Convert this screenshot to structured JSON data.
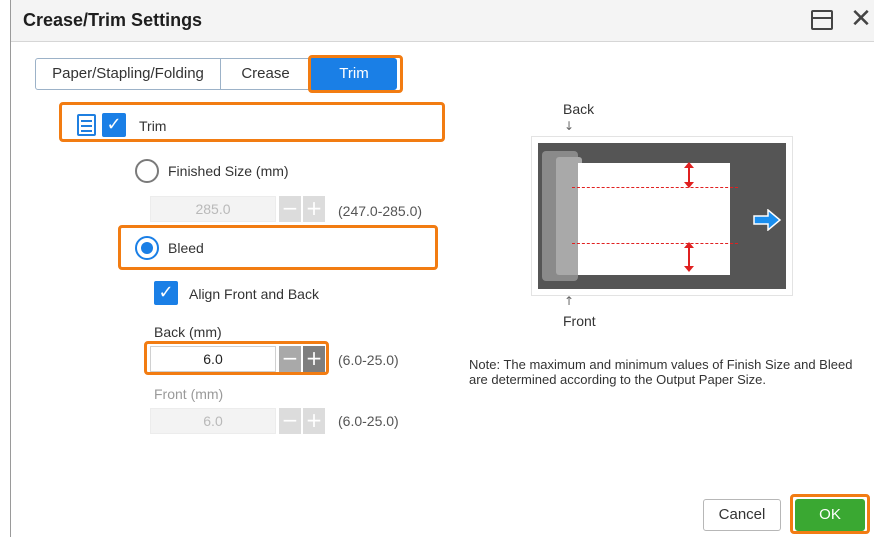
{
  "window": {
    "title": "Crease/Trim Settings"
  },
  "tabs": [
    {
      "label": "Paper/Stapling/Folding"
    },
    {
      "label": "Crease"
    },
    {
      "label": "Trim"
    }
  ],
  "trim": {
    "label": "Trim",
    "checked": true
  },
  "finished_size": {
    "label": "Finished Size (mm)",
    "value": "285.0",
    "range": "(247.0-285.0)",
    "selected": false
  },
  "bleed": {
    "label": "Bleed",
    "selected": true
  },
  "align": {
    "label": "Align Front and Back",
    "checked": true
  },
  "back": {
    "label": "Back (mm)",
    "value": "6.0",
    "range": "(6.0-25.0)"
  },
  "front": {
    "label": "Front (mm)",
    "value": "6.0",
    "range": "(6.0-25.0)"
  },
  "diagram": {
    "back_label": "Back",
    "front_label": "Front"
  },
  "note": "Note: The maximum and minimum values of Finish Size and Bleed are determined according to the Output Paper Size.",
  "buttons": {
    "cancel": "Cancel",
    "ok": "OK"
  },
  "colors": {
    "accent": "#1a7fe6",
    "highlight": "#f27c12",
    "ok": "#3aa832",
    "cut_line": "#e02020"
  }
}
